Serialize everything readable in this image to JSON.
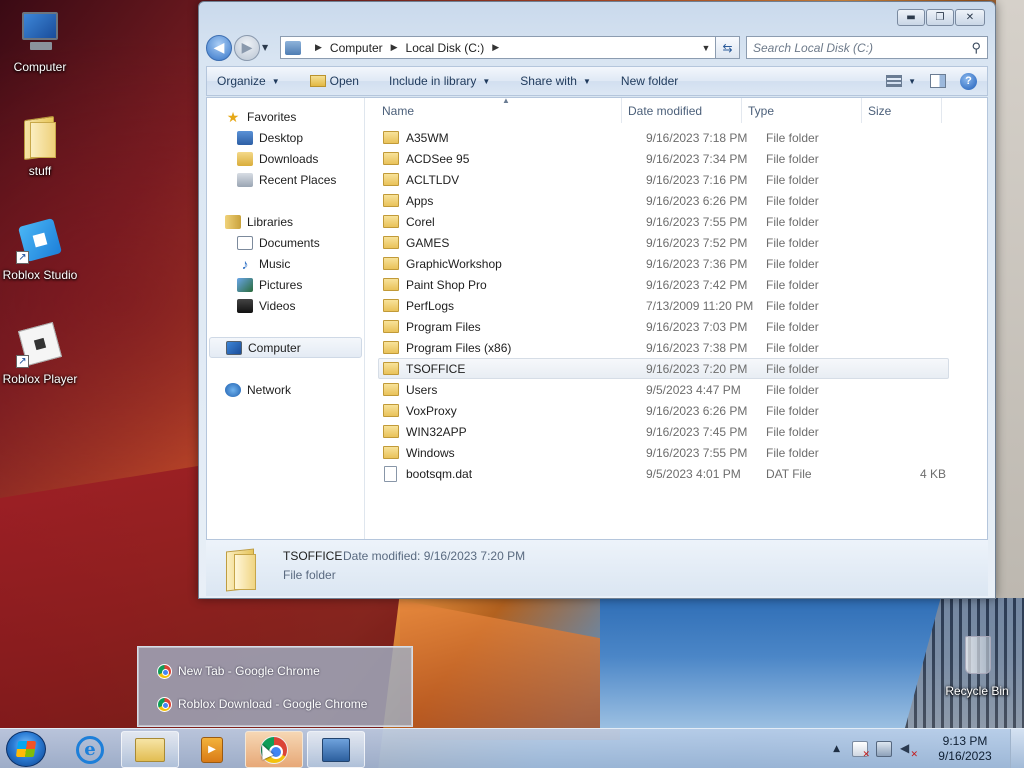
{
  "desktop": {
    "icons": [
      {
        "label": "Computer"
      },
      {
        "label": "stuff"
      },
      {
        "label": "Roblox Studio"
      },
      {
        "label": "Roblox Player"
      },
      {
        "label": "Recycle Bin"
      }
    ]
  },
  "window": {
    "title_buttons": {
      "minimize": "▬",
      "maximize": "❐",
      "close": "✕"
    },
    "address": {
      "crumbs": [
        "Computer",
        "Local Disk (C:)"
      ],
      "icon": "computer-drive-icon"
    },
    "search": {
      "placeholder": "Search Local Disk (C:)"
    },
    "toolbar": {
      "organize": "Organize",
      "open": "Open",
      "include_in_library": "Include in library",
      "share_with": "Share with",
      "new_folder": "New folder"
    },
    "nav": {
      "favorites": "Favorites",
      "desktop": "Desktop",
      "downloads": "Downloads",
      "recent_places": "Recent Places",
      "libraries": "Libraries",
      "documents": "Documents",
      "music": "Music",
      "pictures": "Pictures",
      "videos": "Videos",
      "computer": "Computer",
      "network": "Network"
    },
    "columns": {
      "name": "Name",
      "date": "Date modified",
      "type": "Type",
      "size": "Size"
    },
    "files": [
      {
        "name": "A35WM",
        "date": "9/16/2023 7:18 PM",
        "type": "File folder",
        "size": ""
      },
      {
        "name": "ACDSee 95",
        "date": "9/16/2023 7:34 PM",
        "type": "File folder",
        "size": ""
      },
      {
        "name": "ACLTLDV",
        "date": "9/16/2023 7:16 PM",
        "type": "File folder",
        "size": ""
      },
      {
        "name": "Apps",
        "date": "9/16/2023 6:26 PM",
        "type": "File folder",
        "size": ""
      },
      {
        "name": "Corel",
        "date": "9/16/2023 7:55 PM",
        "type": "File folder",
        "size": ""
      },
      {
        "name": "GAMES",
        "date": "9/16/2023 7:52 PM",
        "type": "File folder",
        "size": ""
      },
      {
        "name": "GraphicWorkshop",
        "date": "9/16/2023 7:36 PM",
        "type": "File folder",
        "size": ""
      },
      {
        "name": "Paint Shop Pro",
        "date": "9/16/2023 7:42 PM",
        "type": "File folder",
        "size": ""
      },
      {
        "name": "PerfLogs",
        "date": "7/13/2009 11:20 PM",
        "type": "File folder",
        "size": ""
      },
      {
        "name": "Program Files",
        "date": "9/16/2023 7:03 PM",
        "type": "File folder",
        "size": ""
      },
      {
        "name": "Program Files (x86)",
        "date": "9/16/2023 7:38 PM",
        "type": "File folder",
        "size": ""
      },
      {
        "name": "TSOFFICE",
        "date": "9/16/2023 7:20 PM",
        "type": "File folder",
        "size": ""
      },
      {
        "name": "Users",
        "date": "9/5/2023 4:47 PM",
        "type": "File folder",
        "size": ""
      },
      {
        "name": "VoxProxy",
        "date": "9/16/2023 6:26 PM",
        "type": "File folder",
        "size": ""
      },
      {
        "name": "WIN32APP",
        "date": "9/16/2023 7:45 PM",
        "type": "File folder",
        "size": ""
      },
      {
        "name": "Windows",
        "date": "9/16/2023 7:55 PM",
        "type": "File folder",
        "size": ""
      },
      {
        "name": "bootsqm.dat",
        "date": "9/5/2023 4:01 PM",
        "type": "DAT File",
        "size": "4 KB"
      }
    ],
    "selected": "TSOFFICE",
    "details": {
      "name": "TSOFFICE",
      "date_modified": "Date modified: 9/16/2023 7:20 PM",
      "type": "File folder"
    }
  },
  "taskbar": {
    "popup": {
      "items": [
        {
          "label": "New Tab - Google Chrome"
        },
        {
          "label": "Roblox Download - Google Chrome"
        }
      ]
    },
    "clock": {
      "time": "9:13 PM",
      "date": "9/16/2023"
    }
  }
}
